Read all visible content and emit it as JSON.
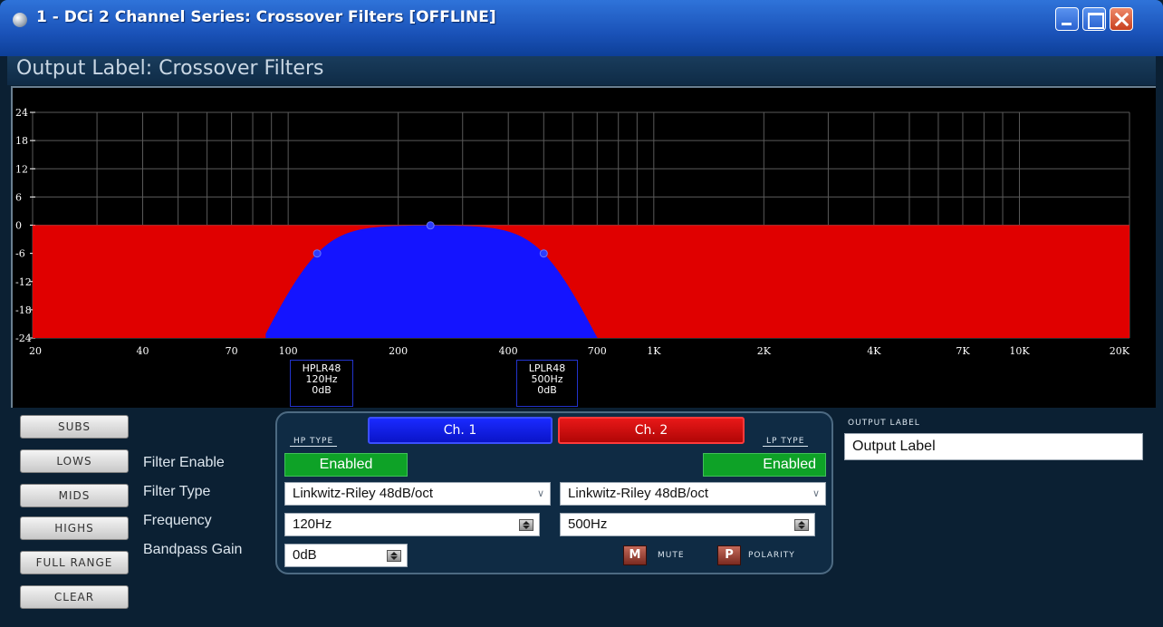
{
  "window": {
    "title": "1 - DCi 2 Channel Series: Crossover Filters [OFFLINE]"
  },
  "label_bar": {
    "text": "Output Label: Crossover Filters"
  },
  "graph": {
    "y_ticks": [
      "24",
      "18",
      "12",
      "6",
      "0",
      "-6",
      "-12",
      "-18",
      "-24"
    ],
    "x_ticks": [
      {
        "label": "20",
        "hz": 20
      },
      {
        "label": "40",
        "hz": 40
      },
      {
        "label": "70",
        "hz": 70
      },
      {
        "label": "100",
        "hz": 100
      },
      {
        "label": "200",
        "hz": 200
      },
      {
        "label": "400",
        "hz": 400
      },
      {
        "label": "700",
        "hz": 700
      },
      {
        "label": "1K",
        "hz": 1000
      },
      {
        "label": "2K",
        "hz": 2000
      },
      {
        "label": "4K",
        "hz": 4000
      },
      {
        "label": "7K",
        "hz": 7000
      },
      {
        "label": "10K",
        "hz": 10000
      },
      {
        "label": "20K",
        "hz": 20000
      }
    ],
    "y_range_db": [
      -24,
      24
    ],
    "x_range_hz": [
      20,
      20000
    ],
    "ch2_level_db": 0,
    "ch1_color": "#1414ff",
    "ch2_color": "#e00000",
    "hp_marker": {
      "name": "HPLR48",
      "freq": "120Hz",
      "gain": "0dB"
    },
    "lp_marker": {
      "name": "LPLR48",
      "freq": "500Hz",
      "gain": "0dB"
    }
  },
  "presets": [
    "SUBS",
    "LOWS",
    "MIDS",
    "HIGHS",
    "FULL RANGE",
    "CLEAR"
  ],
  "param_labels": {
    "filter_enable": "Filter Enable",
    "filter_type": "Filter Type",
    "frequency": "Frequency",
    "bandpass_gain": "Bandpass Gain"
  },
  "channels": {
    "ch1": "Ch. 1",
    "ch2": "Ch. 2"
  },
  "hp": {
    "type_label": "HP TYPE",
    "enabled": "Enabled",
    "filter_type": "Linkwitz-Riley 48dB/oct",
    "frequency": "120Hz"
  },
  "lp": {
    "type_label": "LP TYPE",
    "enabled": "Enabled",
    "filter_type": "Linkwitz-Riley 48dB/oct",
    "frequency": "500Hz"
  },
  "bandpass_gain": "0dB",
  "mute": {
    "button": "M",
    "label": "MUTE"
  },
  "polarity": {
    "button": "P",
    "label": "POLARITY"
  },
  "output_label": {
    "title": "OUTPUT LABEL",
    "value": "Output Label"
  },
  "icons": {
    "dropdown": "chevron-down-icon",
    "spinner": "spin-arrows-icon"
  }
}
